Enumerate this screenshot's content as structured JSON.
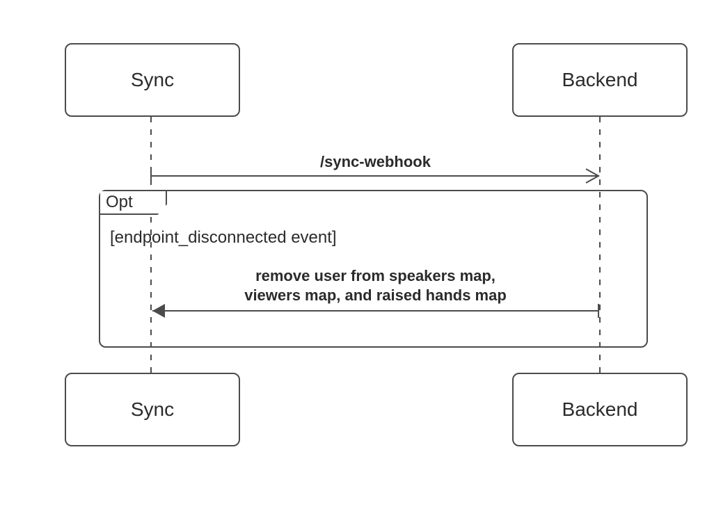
{
  "actors": {
    "sync_top": "Sync",
    "backend_top": "Backend",
    "sync_bottom": "Sync",
    "backend_bottom": "Backend"
  },
  "messages": {
    "m1": "/sync-webhook",
    "m2_line1": "remove user from speakers map,",
    "m2_line2": "viewers map, and raised hands map"
  },
  "opt": {
    "tag": "Opt",
    "guard": "[endpoint_disconnected event]"
  },
  "layout": {
    "syncX": 217,
    "backendX": 862,
    "topBoxTop": 62,
    "topBoxBottom": 168,
    "bottomBoxTop": 536,
    "optTop": 273,
    "optBottom": 500,
    "arrow1Y": 253,
    "arrow2Y": 447
  },
  "colors": {
    "stroke": "#4b4b4b",
    "text": "#2b2b2b"
  }
}
